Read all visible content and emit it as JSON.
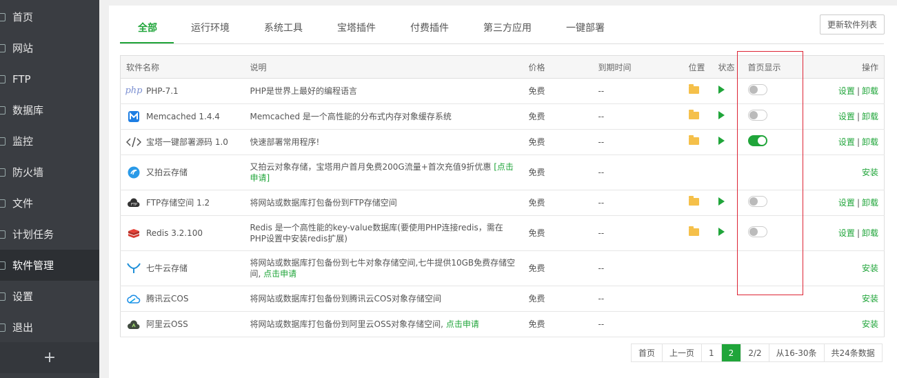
{
  "sidebar": {
    "items": [
      {
        "label": "首页"
      },
      {
        "label": "网站"
      },
      {
        "label": "FTP"
      },
      {
        "label": "数据库"
      },
      {
        "label": "监控"
      },
      {
        "label": "防火墙"
      },
      {
        "label": "文件"
      },
      {
        "label": "计划任务"
      },
      {
        "label": "软件管理",
        "active": true
      },
      {
        "label": "设置"
      },
      {
        "label": "退出"
      }
    ],
    "add_label": "+"
  },
  "tabs": [
    "全部",
    "运行环境",
    "系统工具",
    "宝塔插件",
    "付费插件",
    "第三方应用",
    "一键部署"
  ],
  "refresh_button": "更新软件列表",
  "table": {
    "headers": {
      "name": "软件名称",
      "desc": "说明",
      "price": "价格",
      "expire": "到期时间",
      "location": "位置",
      "status": "状态",
      "homepage": "首页显示",
      "ops": "操作"
    },
    "rows": [
      {
        "icon": "php-icon",
        "name": "PHP-7.1",
        "desc": "PHP是世界上最好的编程语言",
        "desc_link": "",
        "price": "免费",
        "expire": "--",
        "installed": true,
        "home_on": false
      },
      {
        "icon": "memcached-icon",
        "name": "Memcached 1.4.4",
        "desc": "Memcached 是一个高性能的分布式内存对象缓存系统",
        "desc_link": "",
        "price": "免费",
        "expire": "--",
        "installed": true,
        "home_on": false
      },
      {
        "icon": "code-icon",
        "name": "宝塔一键部署源码 1.0",
        "desc": "快速部署常用程序!",
        "desc_link": "",
        "price": "免费",
        "expire": "--",
        "installed": true,
        "home_on": true
      },
      {
        "icon": "upyun-icon",
        "name": "又拍云存储",
        "desc": "又拍云对象存储，宝塔用户首月免费200G流量+首次充值9折优惠 ",
        "desc_link": "[点击申请]",
        "price": "免费",
        "expire": "--",
        "installed": false,
        "home_on": false
      },
      {
        "icon": "ftp-cloud-icon",
        "name": "FTP存储空间 1.2",
        "desc": "将网站或数据库打包备份到FTP存储空间",
        "desc_link": "",
        "price": "免费",
        "expire": "--",
        "installed": true,
        "home_on": false
      },
      {
        "icon": "redis-icon",
        "name": "Redis 3.2.100",
        "desc": "Redis 是一个高性能的key-value数据库(要使用PHP连接redis，需在PHP设置中安装redis扩展)",
        "desc_link": "",
        "price": "免费",
        "expire": "--",
        "installed": true,
        "home_on": false
      },
      {
        "icon": "qiniu-icon",
        "name": "七牛云存储",
        "desc": "将网站或数据库打包备份到七牛对象存储空间,七牛提供10GB免费存储空间, ",
        "desc_link": "点击申请",
        "price": "免费",
        "expire": "--",
        "installed": false,
        "home_on": false
      },
      {
        "icon": "tencent-cloud-icon",
        "name": "腾讯云COS",
        "desc": "将网站或数据库打包备份到腾讯云COS对象存储空间",
        "desc_link": "",
        "price": "免费",
        "expire": "--",
        "installed": false,
        "home_on": false
      },
      {
        "icon": "aliyun-icon",
        "name": "阿里云OSS",
        "desc": "将网站或数据库打包备份到阿里云OSS对象存储空间, ",
        "desc_link": "点击申请",
        "price": "免费",
        "expire": "--",
        "installed": false,
        "home_on": false
      }
    ],
    "op_settings": "设置",
    "op_separator": "|",
    "op_uninstall": "卸载",
    "op_install": "安装"
  },
  "pagination": {
    "first": "首页",
    "prev": "上一页",
    "pages": [
      "1",
      "2"
    ],
    "current": "2",
    "page_of": "2/2",
    "range": "从16-30条",
    "total": "共24条数据"
  },
  "colors": {
    "accent": "#20a53a",
    "sidebar_bg": "#3a3d42",
    "highlight": "#dd2233"
  }
}
